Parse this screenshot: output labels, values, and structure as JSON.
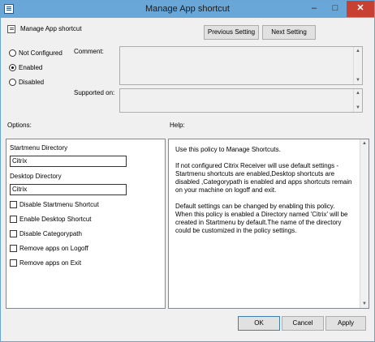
{
  "window": {
    "title": "Manage App shortcut",
    "minimize": "–",
    "maximize": "□",
    "close": "✕"
  },
  "header": {
    "setting_name": "Manage App shortcut",
    "prev_button": "Previous Setting",
    "next_button": "Next Setting"
  },
  "state": {
    "options": [
      {
        "label": "Not Configured",
        "selected": false
      },
      {
        "label": "Enabled",
        "selected": true
      },
      {
        "label": "Disabled",
        "selected": false
      }
    ],
    "comment_label": "Comment:",
    "supported_label": "Supported on:"
  },
  "section_labels": {
    "options": "Options:",
    "help": "Help:"
  },
  "options_panel": {
    "startmenu_label": "Startmenu Directory",
    "startmenu_value": "Citrix",
    "desktop_label": "Desktop Directory",
    "desktop_value": "Citrix",
    "checkboxes": [
      {
        "label": "Disable Startmenu Shortcut",
        "checked": false
      },
      {
        "label": "Enable Desktop Shortcut",
        "checked": false
      },
      {
        "label": "Disable Categorypath",
        "checked": false
      },
      {
        "label": "Remove apps on Logoff",
        "checked": false
      },
      {
        "label": "Remove apps on Exit",
        "checked": false
      }
    ]
  },
  "help_text": "Use this policy to Manage Shortcuts.\n\nIf not configured Citrix Receiver will use default settings -Startmenu shortcuts are enabled,Desktop shortcuts are disabled ,Categorypath is enabled and apps shortcuts remain on your machine on logoff and exit.\n\nDefault settings can be changed by enabling this policy.\nWhen this policy is enabled a Directory named 'Citrix' will be created in Startmenu by default.The name of the directory could be customized in the policy settings.",
  "footer": {
    "ok": "OK",
    "cancel": "Cancel",
    "apply": "Apply"
  },
  "colors": {
    "titlebar": "#6aa7d9",
    "close": "#c84031"
  }
}
